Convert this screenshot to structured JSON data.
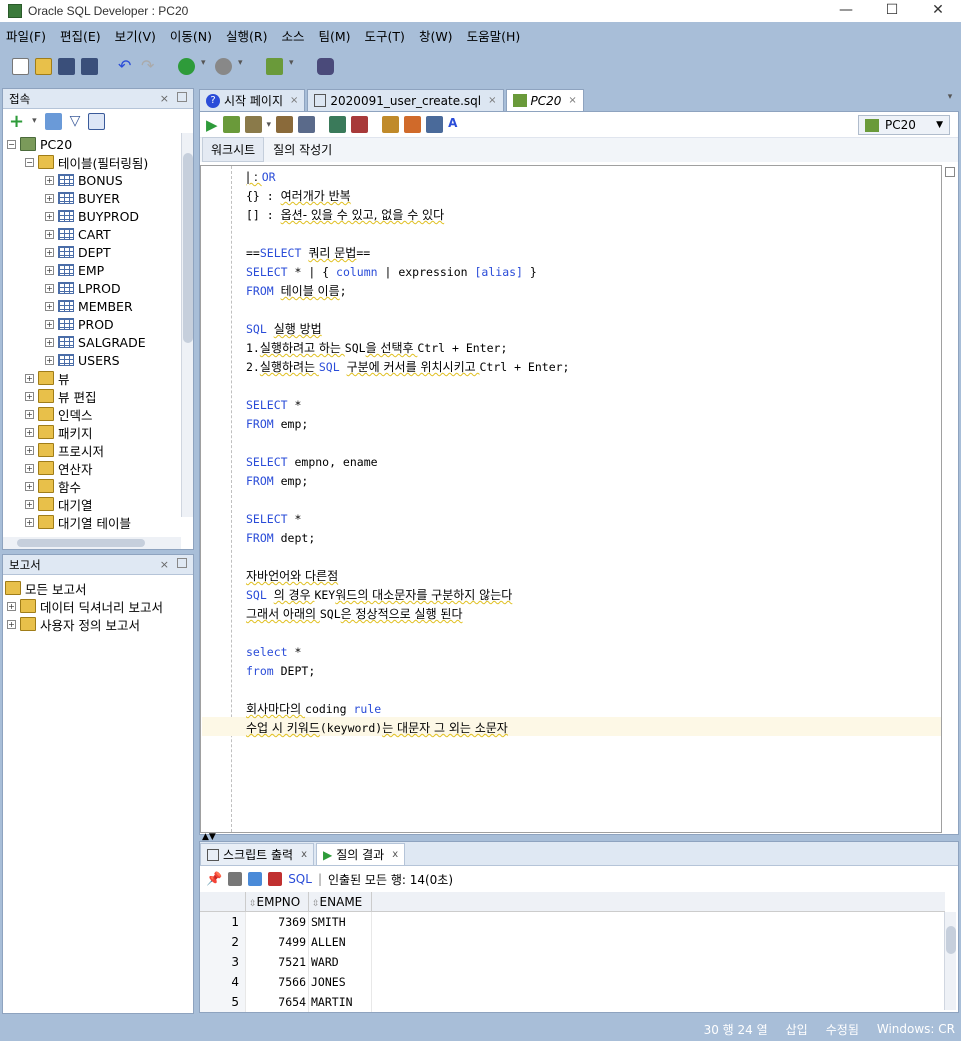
{
  "window": {
    "title": "Oracle SQL Developer : PC20",
    "min": "—",
    "max": "☐",
    "close": "✕"
  },
  "menu": [
    "파일(F)",
    "편집(E)",
    "보기(V)",
    "이동(N)",
    "실행(R)",
    "소스",
    "팀(M)",
    "도구(T)",
    "창(W)",
    "도움말(H)"
  ],
  "connections": {
    "title": "접속",
    "root": "PC20",
    "tables_label": "테이블(필터링됨)",
    "tables": [
      "BONUS",
      "BUYER",
      "BUYPROD",
      "CART",
      "DEPT",
      "EMP",
      "LPROD",
      "MEMBER",
      "PROD",
      "SALGRADE",
      "USERS"
    ],
    "others": [
      "뷰",
      "뷰 편집",
      "인덱스",
      "패키지",
      "프로시저",
      "연산자",
      "함수",
      "대기열",
      "대기열 테이블"
    ]
  },
  "reports": {
    "title": "보고서",
    "items": [
      "모든 보고서",
      "데이터 딕셔너리 보고서",
      "사용자 정의 보고서"
    ]
  },
  "tabs": [
    {
      "label": "시작 페이지"
    },
    {
      "label": "2020091_user_create.sql"
    },
    {
      "label": "PC20"
    }
  ],
  "connection_select": "PC20",
  "subtabs": [
    "워크시트",
    "질의 작성기"
  ],
  "code_lines": [
    {
      "segs": [
        [
          "kr",
          "| : "
        ],
        [
          "kw",
          "OR"
        ]
      ]
    },
    {
      "segs": [
        [
          "",
          "{} : "
        ],
        [
          "kr",
          "여러개가 반복"
        ]
      ]
    },
    {
      "segs": [
        [
          "",
          "[] : "
        ],
        [
          "kr",
          "옵션- 있을 수 있고, 없을 수 있다"
        ]
      ]
    },
    {
      "segs": []
    },
    {
      "segs": [
        [
          "",
          "=="
        ],
        [
          "kw",
          "SELECT "
        ],
        [
          "kr",
          "쿼리 문법"
        ],
        [
          "",
          "=="
        ]
      ]
    },
    {
      "segs": [
        [
          "kw",
          "SELECT"
        ],
        [
          "",
          " * | { "
        ],
        [
          "kw",
          "column"
        ],
        [
          "",
          " | expression "
        ],
        [
          "kw",
          "[alias]"
        ],
        [
          "",
          " }"
        ]
      ]
    },
    {
      "segs": [
        [
          "kw",
          "FROM "
        ],
        [
          "kr",
          "테이블 이름"
        ],
        [
          "",
          ";"
        ]
      ]
    },
    {
      "segs": []
    },
    {
      "segs": [
        [
          "kw",
          "SQL "
        ],
        [
          "kr",
          "실행 방법"
        ]
      ]
    },
    {
      "segs": [
        [
          "",
          "1."
        ],
        [
          "kr",
          "실행하려고 하는 "
        ],
        [
          "",
          "SQL"
        ],
        [
          "kr",
          "을 선택후 "
        ],
        [
          "",
          "Ctrl + Enter;"
        ]
      ]
    },
    {
      "segs": [
        [
          "",
          "2."
        ],
        [
          "kr",
          "실행하려는 "
        ],
        [
          "kw",
          "SQL "
        ],
        [
          "kr",
          "구분에 커서를 위치시키고 "
        ],
        [
          "",
          "Ctrl + Enter;"
        ]
      ]
    },
    {
      "segs": []
    },
    {
      "segs": [
        [
          "kw",
          "SELECT"
        ],
        [
          "",
          " *"
        ]
      ]
    },
    {
      "segs": [
        [
          "kw",
          "FROM"
        ],
        [
          "",
          " emp;"
        ]
      ]
    },
    {
      "segs": []
    },
    {
      "segs": [
        [
          "kw",
          "SELECT"
        ],
        [
          "",
          " empno, ename"
        ]
      ]
    },
    {
      "segs": [
        [
          "kw",
          "FROM"
        ],
        [
          "",
          " emp;"
        ]
      ]
    },
    {
      "segs": []
    },
    {
      "segs": [
        [
          "kw",
          "SELECT"
        ],
        [
          "",
          " *"
        ]
      ]
    },
    {
      "segs": [
        [
          "kw",
          "FROM"
        ],
        [
          "",
          " dept;"
        ]
      ]
    },
    {
      "segs": []
    },
    {
      "segs": [
        [
          "kr",
          "자바언어와 다른점"
        ]
      ]
    },
    {
      "segs": [
        [
          "kw",
          "SQL "
        ],
        [
          "kr",
          "의 경우 "
        ],
        [
          "",
          "KEY"
        ],
        [
          "kr",
          "워드의 대소문자를 구분하지 않는다"
        ]
      ]
    },
    {
      "segs": [
        [
          "kr",
          "그래서 아래의 "
        ],
        [
          "",
          "SQL"
        ],
        [
          "kr",
          "은 정상적으로 실행 된다"
        ]
      ]
    },
    {
      "segs": []
    },
    {
      "segs": [
        [
          "kw",
          "select"
        ],
        [
          "",
          " *"
        ]
      ]
    },
    {
      "segs": [
        [
          "kw",
          "from"
        ],
        [
          "",
          " DEPT;"
        ]
      ]
    },
    {
      "segs": []
    },
    {
      "segs": [
        [
          "kr",
          "회사마다의 "
        ],
        [
          "",
          "coding "
        ],
        [
          "kw",
          "rule"
        ]
      ]
    },
    {
      "segs": [
        [
          "kr",
          "수업 시 키워드"
        ],
        [
          "",
          "(keyword)"
        ],
        [
          "kr",
          "는 대문자 그 외는 소문자"
        ]
      ]
    }
  ],
  "bottom": {
    "tabs": [
      "스크립트 출력",
      "질의 결과"
    ],
    "sql_label": "SQL",
    "fetched": "인출된 모든 행: 14(0초)",
    "columns": [
      "EMPNO",
      "ENAME"
    ],
    "rows": [
      [
        "1",
        "7369",
        "SMITH"
      ],
      [
        "2",
        "7499",
        "ALLEN"
      ],
      [
        "3",
        "7521",
        "WARD"
      ],
      [
        "4",
        "7566",
        "JONES"
      ],
      [
        "5",
        "7654",
        "MARTIN"
      ]
    ]
  },
  "status": {
    "pos": "30 행 24 열",
    "mode": "삽입",
    "modified": "수정됨",
    "eol": "Windows: CR"
  },
  "colors": {
    "keyword": "#2a4cd8",
    "chrome": "#a8bed8",
    "highlight": "#fdf8e6"
  }
}
